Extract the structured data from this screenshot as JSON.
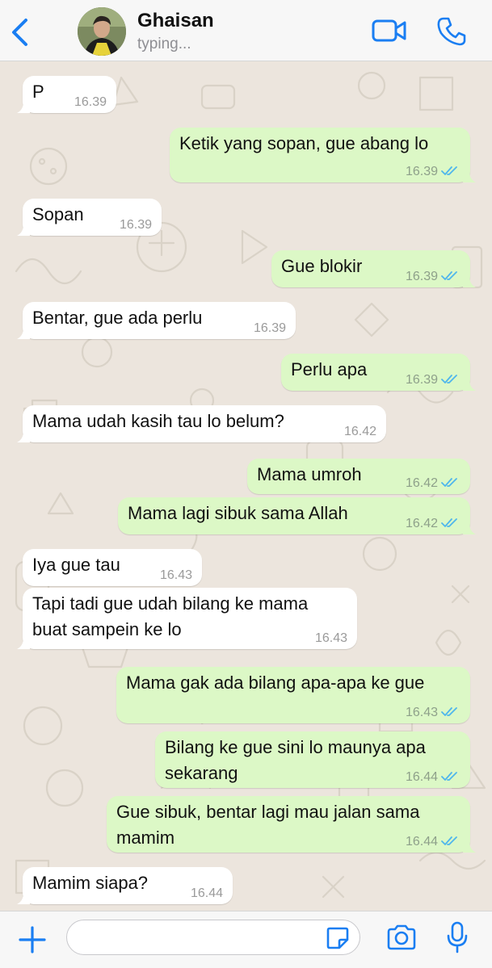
{
  "header": {
    "contact_name": "Ghaisan",
    "status": "typing..."
  },
  "colors": {
    "accent": "#1a7ef2",
    "incoming_bubble": "#ffffff",
    "outgoing_bubble": "#dcf8c6",
    "read_ticks": "#4fb6ec",
    "wallpaper": "#ece5dd"
  },
  "messages": [
    {
      "dir": "in",
      "lines": [
        "P"
      ],
      "time": "16.39"
    },
    {
      "dir": "out",
      "lines": [
        "Ketik yang sopan, gue abang lo"
      ],
      "time": "16.39",
      "read": true
    },
    {
      "dir": "in",
      "lines": [
        "Sopan"
      ],
      "time": "16.39"
    },
    {
      "dir": "out",
      "lines": [
        "Gue blokir"
      ],
      "time": "16.39",
      "read": true
    },
    {
      "dir": "in",
      "lines": [
        "Bentar, gue ada perlu"
      ],
      "time": "16.39"
    },
    {
      "dir": "out",
      "lines": [
        "Perlu apa"
      ],
      "time": "16.39",
      "read": true
    },
    {
      "dir": "in",
      "lines": [
        "Mama udah kasih tau lo belum?"
      ],
      "time": "16.42"
    },
    {
      "dir": "out",
      "lines": [
        "Mama umroh"
      ],
      "time": "16.42",
      "read": true
    },
    {
      "dir": "out",
      "lines": [
        "Mama lagi sibuk sama Allah"
      ],
      "time": "16.42",
      "read": true
    },
    {
      "dir": "in",
      "lines": [
        "Iya gue tau"
      ],
      "time": "16.43"
    },
    {
      "dir": "in",
      "lines": [
        "Tapi tadi gue udah bilang ke mama",
        "buat sampein ke lo"
      ],
      "time": "16.43"
    },
    {
      "dir": "out",
      "lines": [
        "Mama gak ada bilang apa-apa ke gue"
      ],
      "time": "16.43",
      "read": true
    },
    {
      "dir": "out",
      "lines": [
        "Bilang ke gue sini lo maunya apa",
        "sekarang"
      ],
      "time": "16.44",
      "read": true
    },
    {
      "dir": "out",
      "lines": [
        "Gue sibuk, bentar lagi mau jalan sama",
        "mamim"
      ],
      "time": "16.44",
      "read": true
    },
    {
      "dir": "in",
      "lines": [
        "Mamim siapa?"
      ],
      "time": "16.44"
    }
  ],
  "composer": {
    "input_value": "",
    "icons": [
      "plus-icon",
      "sticker-icon",
      "camera-icon",
      "microphone-icon"
    ]
  }
}
